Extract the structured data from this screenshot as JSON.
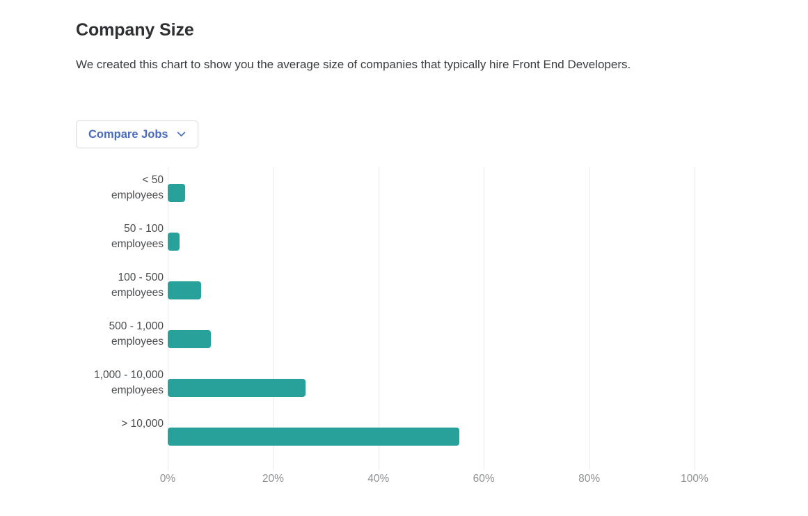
{
  "header": {
    "title": "Company Size",
    "description": "We created this chart to show you the average size of companies that typically hire Front End Developers."
  },
  "controls": {
    "compare_jobs_label": "Compare Jobs",
    "chevron_icon": "chevron-down-icon"
  },
  "colors": {
    "bar": "#27a19a",
    "accent_link": "#4a6bbd",
    "gridline": "#e9eaec",
    "axis_text": "#8e9194",
    "category_text": "#4a4d50",
    "title_text": "#2e3033"
  },
  "chart_data": {
    "type": "bar",
    "orientation": "horizontal",
    "title": "Company Size",
    "xlabel": "",
    "ylabel": "",
    "xlim": [
      0,
      100
    ],
    "grid": true,
    "legend": false,
    "xticks": [
      "0%",
      "20%",
      "40%",
      "60%",
      "80%",
      "100%"
    ],
    "xtick_values": [
      0,
      20,
      40,
      60,
      80,
      100
    ],
    "categories": [
      "< 50\nemployees",
      "50 - 100\nemployees",
      "100 - 500\nemployees",
      "500 - 1,000\nemployees",
      "1,000 - 10,000\nemployees",
      "> 10,000"
    ],
    "values": [
      3.3,
      2.2,
      6.4,
      8.2,
      26.2,
      55.3
    ],
    "value_unit": "%"
  }
}
